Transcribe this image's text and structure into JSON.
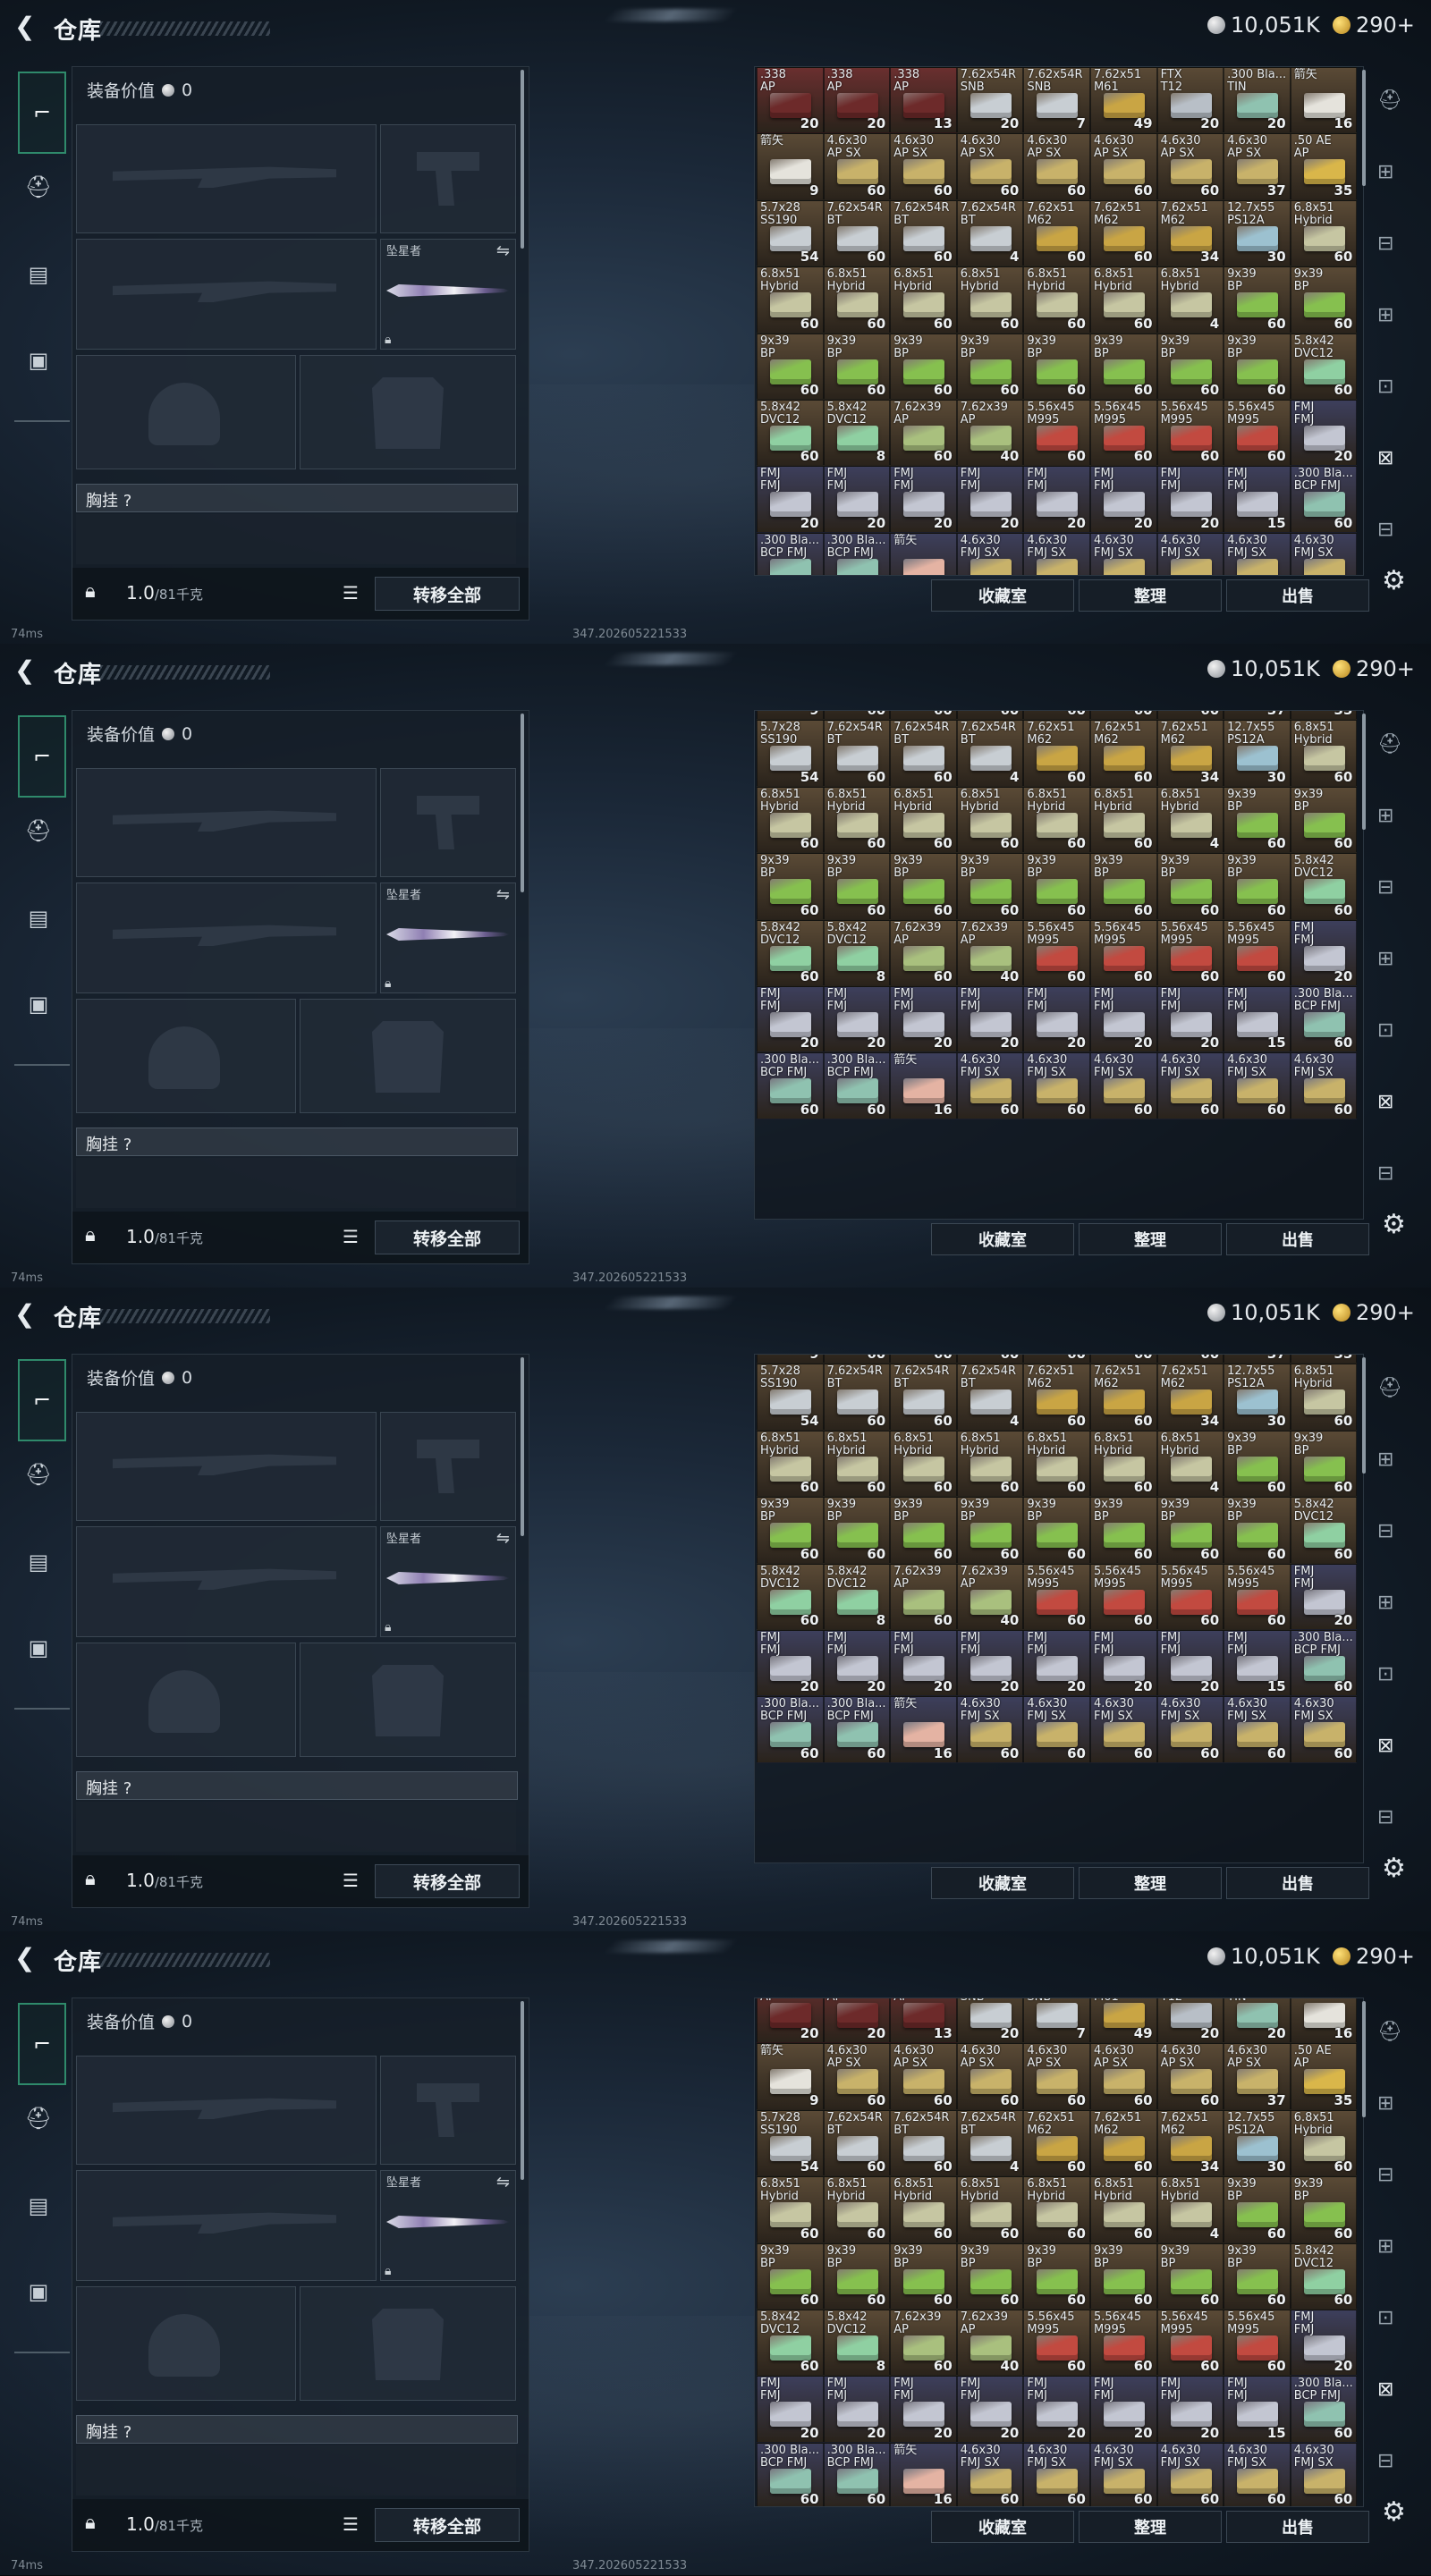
{
  "header": {
    "title": "仓库",
    "silver_amount": "10,051K",
    "gold_amount": "290+"
  },
  "equipment": {
    "value_label": "装备价值",
    "value_amount": "0",
    "secondary_slot_label": "坠星者",
    "rig_label": "胸挂",
    "rig_question": "?",
    "weight_current": "1.0",
    "weight_max": "/81千克",
    "transfer_all_label": "转移全部"
  },
  "inventory": {
    "buttons": {
      "collection": "收藏室",
      "organize": "整理",
      "sell": "出售"
    }
  },
  "status": {
    "ping": "74ms",
    "build": "347.202605221533"
  },
  "colors": {
    "accent": "#2f8a6b",
    "box_grey": "#bfc6cc",
    "box_yellow": "#c9a544",
    "box_red": "#b33a3a",
    "box_green": "#7fb24a",
    "box_blue": "#8fb3c4",
    "box_violet": "#9ea3c9",
    "cell_brown": "#5a4a36",
    "cell_red": "#6a2f2f",
    "cell_violet": "#3d3f5c"
  },
  "items": [
    {
      "name": ".338\nAP",
      "count": "20",
      "box": "#6d2a2a",
      "bg": "#6a2f2f"
    },
    {
      "name": ".338\nAP",
      "count": "20",
      "box": "#6d2a2a",
      "bg": "#6a2f2f"
    },
    {
      "name": ".338\nAP",
      "count": "13",
      "box": "#6d2a2a",
      "bg": "#6a2f2f"
    },
    {
      "name": "7.62x54R\nSNB",
      "count": "20",
      "box": "#c8ced3",
      "bg": "#5a4a36"
    },
    {
      "name": "7.62x54R\nSNB",
      "count": "7",
      "box": "#c8ced3",
      "bg": "#5a4a36"
    },
    {
      "name": "7.62x51\nM61",
      "count": "49",
      "box": "#c9a544",
      "bg": "#5a4a36"
    },
    {
      "name": "FTX\nT12",
      "count": "20",
      "box": "#b8bfc7",
      "bg": "#5a4a36"
    },
    {
      "name": ".300 Bla...\nTIN",
      "count": "20",
      "box": "#8fc2b0",
      "bg": "#5a4a36"
    },
    {
      "name": "箭矢",
      "count": "16",
      "box": "#e5e3dc",
      "bg": "#5a4a36"
    },
    {
      "name": "箭矢",
      "count": "9",
      "box": "#e5e3dc",
      "bg": "#5a4a36"
    },
    {
      "name": "4.6x30\nAP SX",
      "count": "60",
      "box": "#c8b26a",
      "bg": "#5a4a36"
    },
    {
      "name": "4.6x30\nAP SX",
      "count": "60",
      "box": "#c8b26a",
      "bg": "#5a4a36"
    },
    {
      "name": "4.6x30\nAP SX",
      "count": "60",
      "box": "#c8b26a",
      "bg": "#5a4a36"
    },
    {
      "name": "4.6x30\nAP SX",
      "count": "60",
      "box": "#c8b26a",
      "bg": "#5a4a36"
    },
    {
      "name": "4.6x30\nAP SX",
      "count": "60",
      "box": "#c8b26a",
      "bg": "#5a4a36"
    },
    {
      "name": "4.6x30\nAP SX",
      "count": "60",
      "box": "#c8b26a",
      "bg": "#5a4a36"
    },
    {
      "name": "4.6x30\nAP SX",
      "count": "37",
      "box": "#c8b26a",
      "bg": "#5a4a36"
    },
    {
      "name": ".50 AE\nAP",
      "count": "35",
      "box": "#d9b64a",
      "bg": "#5a4a36"
    },
    {
      "name": "5.7x28\nSS190",
      "count": "54",
      "box": "#c8ced3",
      "bg": "#5a4a36"
    },
    {
      "name": "7.62x54R\nBT",
      "count": "60",
      "box": "#c8ced3",
      "bg": "#5a4a36"
    },
    {
      "name": "7.62x54R\nBT",
      "count": "60",
      "box": "#c8ced3",
      "bg": "#5a4a36"
    },
    {
      "name": "7.62x54R\nBT",
      "count": "4",
      "box": "#c8ced3",
      "bg": "#5a4a36"
    },
    {
      "name": "7.62x51\nM62",
      "count": "60",
      "box": "#c9a544",
      "bg": "#5a4a36"
    },
    {
      "name": "7.62x51\nM62",
      "count": "60",
      "box": "#c9a544",
      "bg": "#5a4a36"
    },
    {
      "name": "7.62x51\nM62",
      "count": "34",
      "box": "#c9a544",
      "bg": "#5a4a36"
    },
    {
      "name": "12.7x55\nPS12A",
      "count": "30",
      "box": "#9cc1d0",
      "bg": "#5a4a36"
    },
    {
      "name": "6.8x51\nHybrid",
      "count": "60",
      "box": "#c6c6a2",
      "bg": "#5a4a36"
    },
    {
      "name": "6.8x51\nHybrid",
      "count": "60",
      "box": "#c6c6a2",
      "bg": "#5a4a36"
    },
    {
      "name": "6.8x51\nHybrid",
      "count": "60",
      "box": "#c6c6a2",
      "bg": "#5a4a36"
    },
    {
      "name": "6.8x51\nHybrid",
      "count": "60",
      "box": "#c6c6a2",
      "bg": "#5a4a36"
    },
    {
      "name": "6.8x51\nHybrid",
      "count": "60",
      "box": "#c6c6a2",
      "bg": "#5a4a36"
    },
    {
      "name": "6.8x51\nHybrid",
      "count": "60",
      "box": "#c6c6a2",
      "bg": "#5a4a36"
    },
    {
      "name": "6.8x51\nHybrid",
      "count": "60",
      "box": "#c6c6a2",
      "bg": "#5a4a36"
    },
    {
      "name": "6.8x51\nHybrid",
      "count": "4",
      "box": "#c6c6a2",
      "bg": "#5a4a36"
    },
    {
      "name": "9x39\nBP",
      "count": "60",
      "box": "#86c04f",
      "bg": "#5a4a36"
    },
    {
      "name": "9x39\nBP",
      "count": "60",
      "box": "#86c04f",
      "bg": "#5a4a36"
    },
    {
      "name": "9x39\nBP",
      "count": "60",
      "box": "#86c04f",
      "bg": "#5a4a36"
    },
    {
      "name": "9x39\nBP",
      "count": "60",
      "box": "#86c04f",
      "bg": "#5a4a36"
    },
    {
      "name": "9x39\nBP",
      "count": "60",
      "box": "#86c04f",
      "bg": "#5a4a36"
    },
    {
      "name": "9x39\nBP",
      "count": "60",
      "box": "#86c04f",
      "bg": "#5a4a36"
    },
    {
      "name": "9x39\nBP",
      "count": "60",
      "box": "#86c04f",
      "bg": "#5a4a36"
    },
    {
      "name": "9x39\nBP",
      "count": "60",
      "box": "#86c04f",
      "bg": "#5a4a36"
    },
    {
      "name": "9x39\nBP",
      "count": "60",
      "box": "#86c04f",
      "bg": "#5a4a36"
    },
    {
      "name": "9x39\nBP",
      "count": "60",
      "box": "#86c04f",
      "bg": "#5a4a36"
    },
    {
      "name": "5.8x42\nDVC12",
      "count": "60",
      "box": "#8fd0a2",
      "bg": "#5a4a36"
    },
    {
      "name": "5.8x42\nDVC12",
      "count": "60",
      "box": "#8fd0a2",
      "bg": "#5a4a36"
    },
    {
      "name": "5.8x42\nDVC12",
      "count": "8",
      "box": "#8fd0a2",
      "bg": "#5a4a36"
    },
    {
      "name": "7.62x39\nAP",
      "count": "60",
      "box": "#a9c07e",
      "bg": "#5a4a36"
    },
    {
      "name": "7.62x39\nAP",
      "count": "40",
      "box": "#a9c07e",
      "bg": "#5a4a36"
    },
    {
      "name": "5.56x45\nM995",
      "count": "60",
      "box": "#c24a40",
      "bg": "#5a4a36"
    },
    {
      "name": "5.56x45\nM995",
      "count": "60",
      "box": "#c24a40",
      "bg": "#5a4a36"
    },
    {
      "name": "5.56x45\nM995",
      "count": "60",
      "box": "#c24a40",
      "bg": "#5a4a36"
    },
    {
      "name": "5.56x45\nM995",
      "count": "60",
      "box": "#c24a40",
      "bg": "#5a4a36"
    },
    {
      "name": "FMJ\nFMJ",
      "count": "20",
      "box": "#c3c6d2",
      "bg": "#3d3f5c"
    },
    {
      "name": "FMJ\nFMJ",
      "count": "20",
      "box": "#c3c6d2",
      "bg": "#3d3f5c"
    },
    {
      "name": "FMJ\nFMJ",
      "count": "20",
      "box": "#c3c6d2",
      "bg": "#3d3f5c"
    },
    {
      "name": "FMJ\nFMJ",
      "count": "20",
      "box": "#c3c6d2",
      "bg": "#3d3f5c"
    },
    {
      "name": "FMJ\nFMJ",
      "count": "20",
      "box": "#c3c6d2",
      "bg": "#3d3f5c"
    },
    {
      "name": "FMJ\nFMJ",
      "count": "20",
      "box": "#c3c6d2",
      "bg": "#3d3f5c"
    },
    {
      "name": "FMJ\nFMJ",
      "count": "20",
      "box": "#c3c6d2",
      "bg": "#3d3f5c"
    },
    {
      "name": "FMJ\nFMJ",
      "count": "20",
      "box": "#c3c6d2",
      "bg": "#3d3f5c"
    },
    {
      "name": "FMJ\nFMJ",
      "count": "15",
      "box": "#c3c6d2",
      "bg": "#3d3f5c"
    },
    {
      "name": ".300 Bla...\nBCP FMJ",
      "count": "60",
      "box": "#8fc2b0",
      "bg": "#3d3f5c"
    },
    {
      "name": ".300 Bla...\nBCP FMJ",
      "count": "60",
      "box": "#8fc2b0",
      "bg": "#3d3f5c"
    },
    {
      "name": ".300 Bla...\nBCP FMJ",
      "count": "60",
      "box": "#8fc2b0",
      "bg": "#3d3f5c"
    },
    {
      "name": "箭矢",
      "count": "16",
      "box": "#e4b3a3",
      "bg": "#3d3f5c"
    },
    {
      "name": "4.6x30\nFMJ SX",
      "count": "60",
      "box": "#c8b26a",
      "bg": "#3d3f5c"
    },
    {
      "name": "4.6x30\nFMJ SX",
      "count": "60",
      "box": "#c8b26a",
      "bg": "#3d3f5c"
    },
    {
      "name": "4.6x30\nFMJ SX",
      "count": "60",
      "box": "#c8b26a",
      "bg": "#3d3f5c"
    },
    {
      "name": "4.6x30\nFMJ SX",
      "count": "60",
      "box": "#c8b26a",
      "bg": "#3d3f5c"
    },
    {
      "name": "4.6x30\nFMJ SX",
      "count": "60",
      "box": "#c8b26a",
      "bg": "#3d3f5c"
    },
    {
      "name": "4.6x30\nFMJ SX",
      "count": "60",
      "box": "#c8b26a",
      "bg": "#3d3f5c"
    }
  ]
}
